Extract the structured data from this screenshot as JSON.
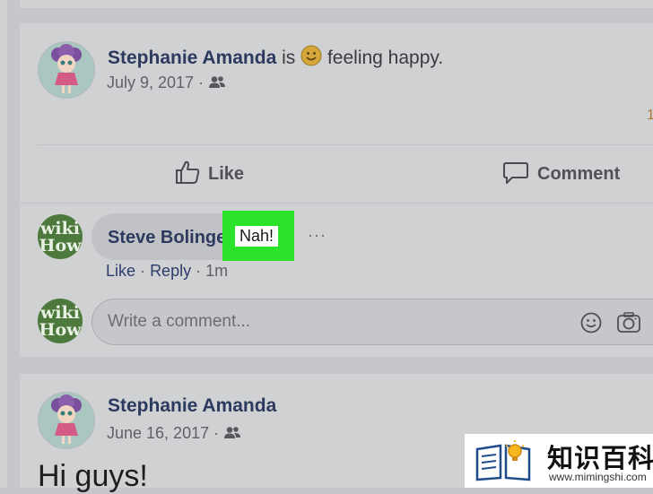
{
  "post1": {
    "author": "Stephanie Amanda",
    "is_text": "is",
    "activity": "feeling happy.",
    "date": "July 9, 2017",
    "dot": "·",
    "stray_char": "1"
  },
  "actions": {
    "like_label": "Like",
    "comment_label": "Comment"
  },
  "comment": {
    "author": "Steve Bolinge",
    "text": "Nah!",
    "more": "···",
    "like": "Like",
    "reply": "Reply",
    "time": "1m",
    "sep": "·"
  },
  "composer": {
    "placeholder": "Write a comment..."
  },
  "post2": {
    "author": "Stephanie Amanda",
    "date": "June 16, 2017",
    "dot": "·",
    "body": "Hi guys!"
  },
  "wikihow_avatar": {
    "line1": "wiki",
    "line2": "How"
  },
  "watermark": {
    "title": "知识百科",
    "url": "www.mimingshi.com"
  },
  "colors": {
    "highlight": "#2ce32c",
    "name": "#2b3a5e",
    "background": "#c6c7ca",
    "card": "#d0d1d3"
  }
}
